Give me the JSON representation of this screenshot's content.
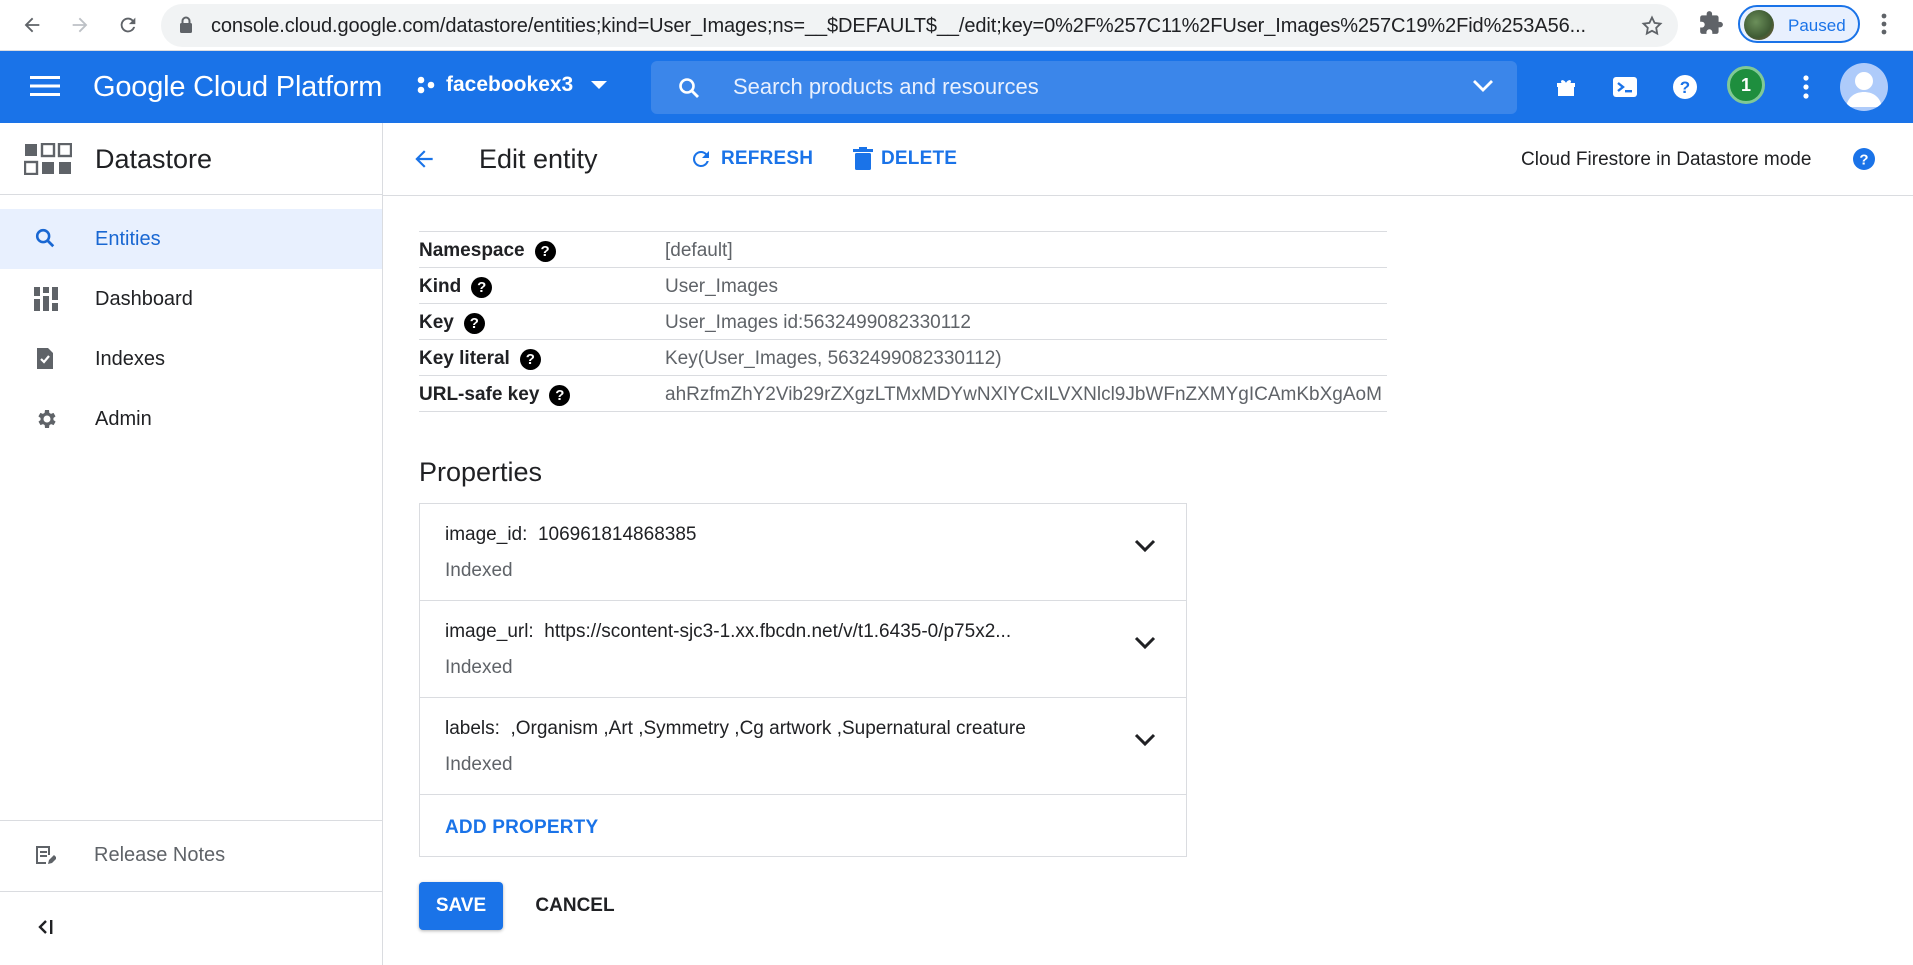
{
  "browser": {
    "url": "console.cloud.google.com/datastore/entities;kind=User_Images;ns=__$DEFAULT$__/edit;key=0%2F%257C11%2FUser_Images%257C19%2Fid%253A56...",
    "profile_status": "Paused"
  },
  "topbar": {
    "brand": "Google Cloud Platform",
    "project": "facebookex3",
    "search_placeholder": "Search products and resources",
    "notification_count": "1",
    "brand_color": "#1a73e8"
  },
  "sidebar": {
    "product_title": "Datastore",
    "items": [
      {
        "label": "Entities",
        "icon": "search-icon",
        "active": true
      },
      {
        "label": "Dashboard",
        "icon": "dashboard-icon",
        "active": false
      },
      {
        "label": "Indexes",
        "icon": "indexes-icon",
        "active": false
      },
      {
        "label": "Admin",
        "icon": "gear-icon",
        "active": false
      }
    ],
    "release_notes": "Release Notes"
  },
  "header": {
    "title": "Edit entity",
    "refresh_label": "REFRESH",
    "delete_label": "DELETE",
    "mode": "Cloud Firestore in Datastore mode"
  },
  "meta": [
    {
      "key": "Namespace",
      "value": "[default]"
    },
    {
      "key": "Kind",
      "value": "User_Images"
    },
    {
      "key": "Key",
      "value": "User_Images id:5632499082330112"
    },
    {
      "key": "Key literal",
      "value": "Key(User_Images, 5632499082330112)"
    },
    {
      "key": "URL-safe key",
      "value": "ahRzfmZhY2Vib29rZXgzLTMxMDYwNXlYCxILVXNlcl9JbWFnZXMYgICAmKbXgAoM"
    }
  ],
  "properties_title": "Properties",
  "properties": [
    {
      "name": "image_id:",
      "value": "106961814868385",
      "index_label": "Indexed"
    },
    {
      "name": "image_url:",
      "value": "https://scontent-sjc3-1.xx.fbcdn.net/v/t1.6435-0/p75x2...",
      "index_label": "Indexed"
    },
    {
      "name": "labels:",
      "value": ",Organism ,Art ,Symmetry ,Cg artwork ,Supernatural creature",
      "index_label": "Indexed"
    }
  ],
  "add_property_label": "ADD PROPERTY",
  "save_label": "SAVE",
  "cancel_label": "CANCEL"
}
